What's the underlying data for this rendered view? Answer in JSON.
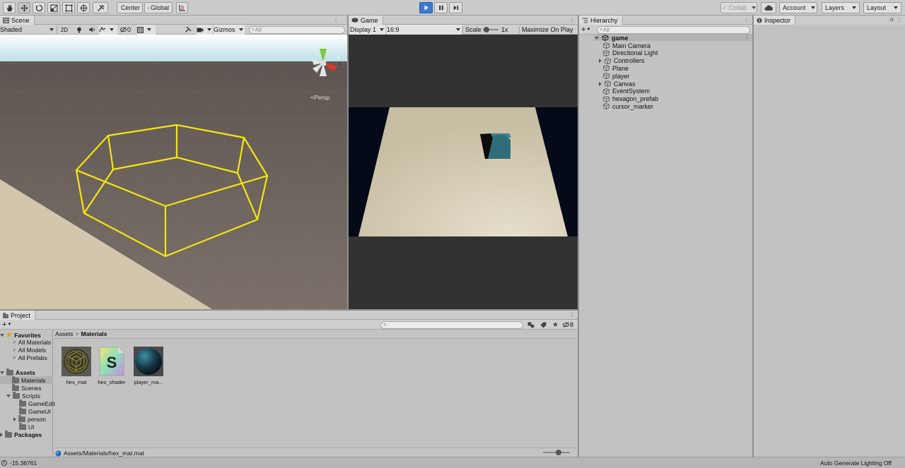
{
  "toolbar": {
    "tools": [
      "hand-tool",
      "move-tool",
      "rotate-tool",
      "scale-tool",
      "rect-tool",
      "transform-tool",
      "custom-tool"
    ],
    "center_label": "Center",
    "global_label": "Global",
    "collab_label": "Collab",
    "account_label": "Account",
    "layers_label": "Layers",
    "layout_label": "Layout"
  },
  "scene": {
    "tab_label": "Scene",
    "draw_mode": "Shaded",
    "mode_2d": "2D",
    "hidden_count": "0",
    "gizmos_label": "Gizmos",
    "search_placeholder": "All",
    "persp_label": "Persp"
  },
  "game": {
    "tab_label": "Game",
    "display": "Display 1",
    "aspect": "16:9",
    "scale_label": "Scale",
    "scale_value": "1x",
    "maximize_label": "Maximize On Play"
  },
  "hierarchy": {
    "tab_label": "Hierarchy",
    "search_placeholder": "All",
    "scene_name": "game",
    "items": [
      {
        "label": "Main Camera",
        "expandable": false
      },
      {
        "label": "Directional Light",
        "expandable": false
      },
      {
        "label": "Controllers",
        "expandable": true
      },
      {
        "label": "Plane",
        "expandable": false
      },
      {
        "label": "player",
        "expandable": false
      },
      {
        "label": "Canvas",
        "expandable": true
      },
      {
        "label": "EventSystem",
        "expandable": false
      },
      {
        "label": "hexagon_prefab",
        "expandable": false
      },
      {
        "label": "cursor_marker",
        "expandable": false
      }
    ]
  },
  "inspector": {
    "tab_label": "Inspector"
  },
  "project": {
    "tab_label": "Project",
    "hidden_count": "8",
    "favorites_label": "Favorites",
    "favorites": [
      "All Materials",
      "All Models",
      "All Prefabs"
    ],
    "assets_label": "Assets",
    "assets_tree": {
      "materials": "Materials",
      "scenes": "Scenes",
      "scripts": "Scripts",
      "game_editor": "GameEdit",
      "game_ui": "GameUI",
      "person": "person",
      "ui": "UI"
    },
    "packages_label": "Packages",
    "breadcrumb": [
      "Assets",
      "Materials"
    ],
    "assets": [
      {
        "name": "hex_mat",
        "icon": "hex-material-thumbnail"
      },
      {
        "name": "hex_shader",
        "icon": "shader-s-icon"
      },
      {
        "name": "player_ma...",
        "icon": "sphere-material-thumbnail"
      }
    ],
    "shader_letter": "S",
    "selected_path": "Assets/Materials/hex_mat.mat"
  },
  "status": {
    "message": "-15.36761",
    "lighting": "Auto Generate Lighting Off"
  },
  "colors": {
    "play_button": "#3b78d4",
    "selection_outline": "#f5e50f",
    "player_cube": "#2f6d7a",
    "ground_plane": "#d2c7ad"
  }
}
